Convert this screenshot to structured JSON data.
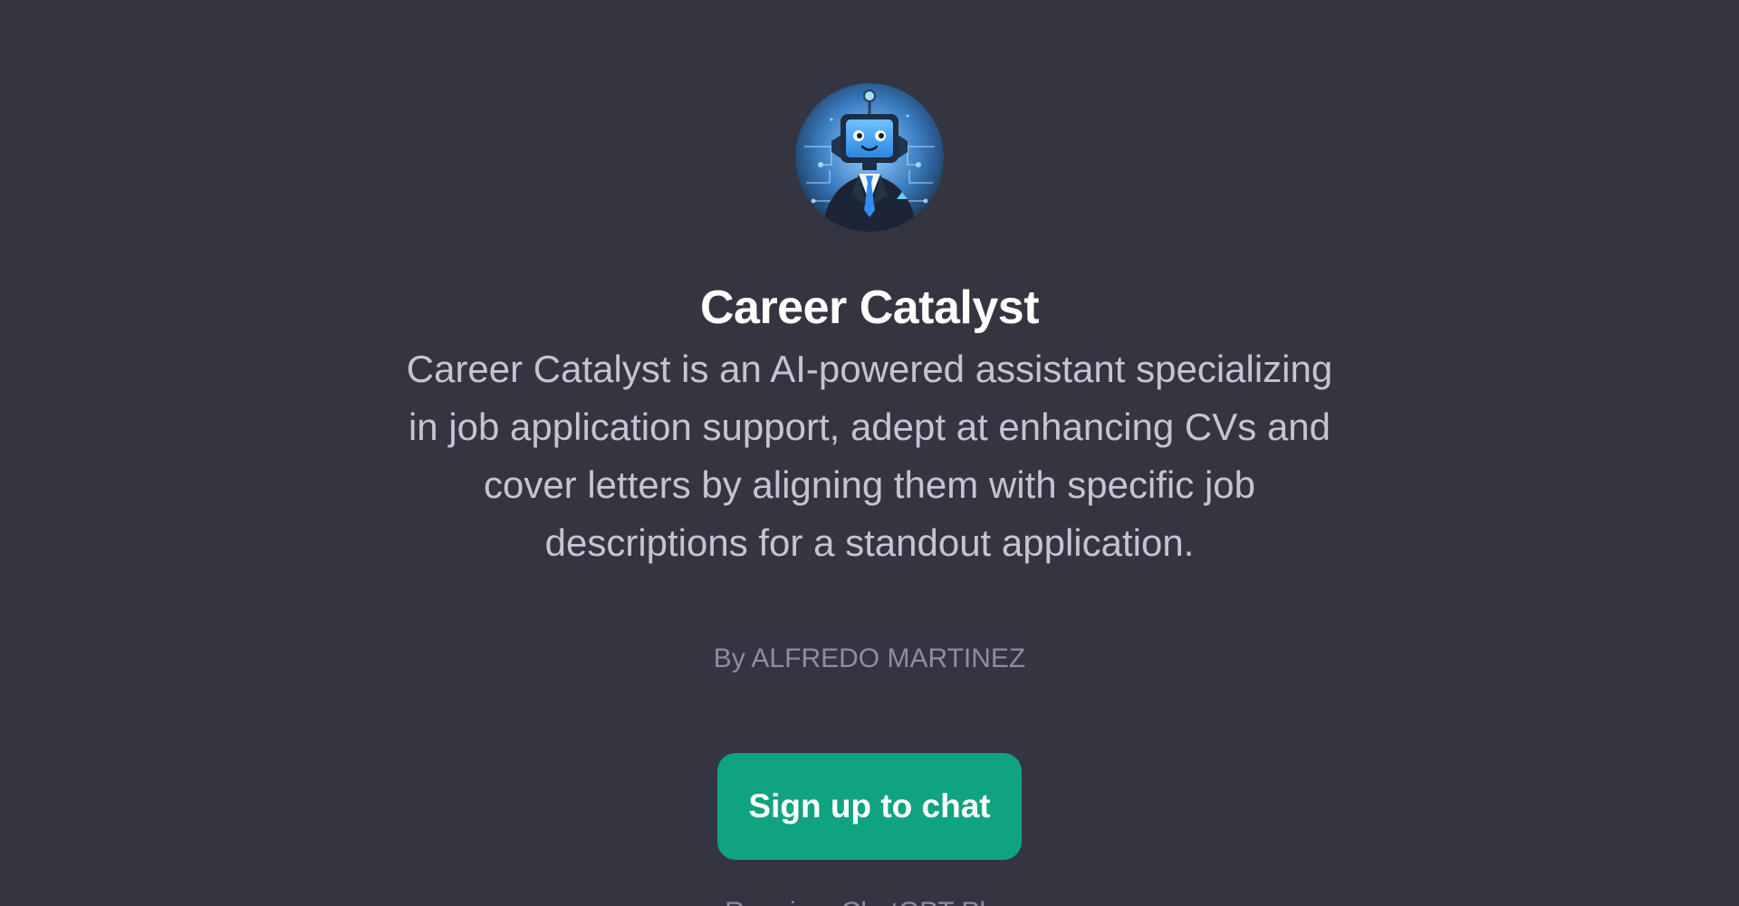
{
  "gpt": {
    "avatar_icon": "robot-in-suit-avatar",
    "title": "Career Catalyst",
    "description": "Career Catalyst is an AI-powered assistant specializing in job application support, adept at enhancing CVs and cover letters by aligning them with specific job descriptions for a standout application.",
    "author": "By ALFREDO MARTINEZ"
  },
  "cta": {
    "label": "Sign up to chat"
  },
  "footer": {
    "note": "Requires ChatGPT Plus"
  },
  "colors": {
    "background": "#343541",
    "title": "#ffffff",
    "description": "#c5c5d2",
    "muted": "#8e8ea0",
    "accent": "#10a37f"
  }
}
